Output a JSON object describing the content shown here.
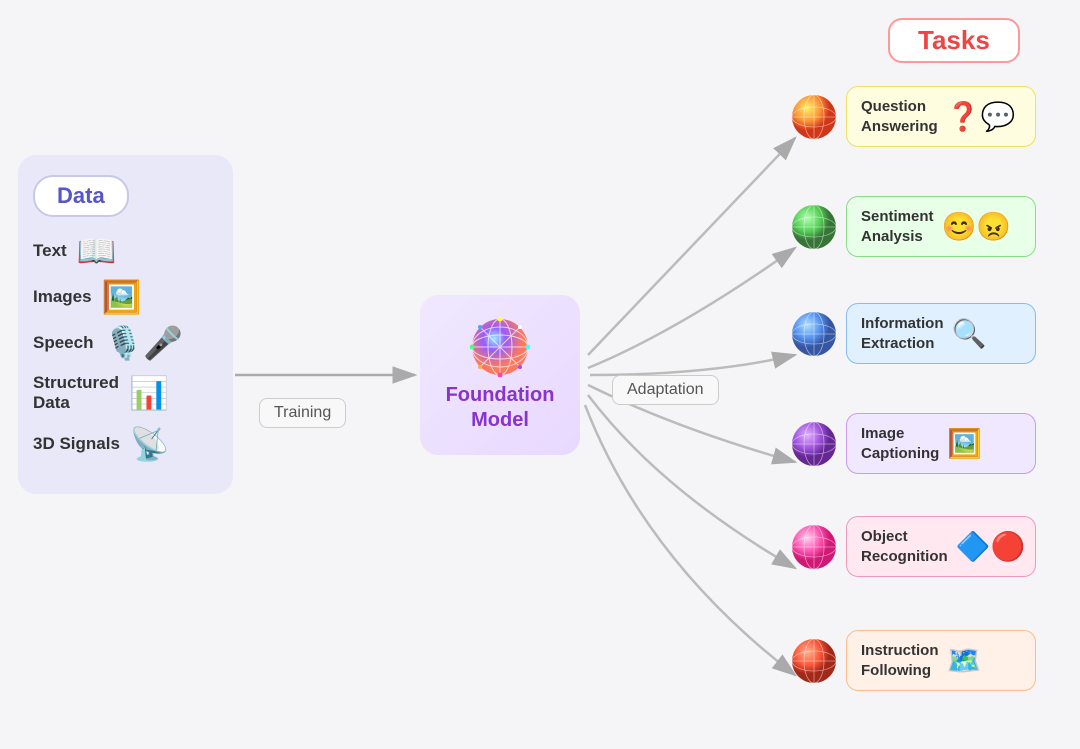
{
  "data_panel": {
    "title": "Data",
    "items": [
      {
        "label": "Text",
        "emoji": "📖"
      },
      {
        "label": "Images",
        "emoji": "🖼️"
      },
      {
        "label": "Speech",
        "emoji": "🎤"
      },
      {
        "label": "Structured Data",
        "emoji": "📊"
      },
      {
        "label": "3D Signals",
        "emoji": "📡"
      }
    ]
  },
  "training_label": "Training",
  "foundation_model_label": "Foundation\nModel",
  "adaptation_label": "Adaptation",
  "tasks_title": "Tasks",
  "tasks": [
    {
      "label": "Question\nAnswering",
      "emoji": "❓💬",
      "bg_class": "bg-yellow",
      "sphere_color1": "#ff6633",
      "sphere_color2": "#ffcc22"
    },
    {
      "label": "Sentiment\nAnalysis",
      "emoji": "😊😠",
      "bg_class": "bg-green",
      "sphere_color1": "#44cc44",
      "sphere_color2": "#88ff44"
    },
    {
      "label": "Information\nExtraction",
      "emoji": "🔍",
      "bg_class": "bg-blue",
      "sphere_color1": "#4488ff",
      "sphere_color2": "#88ccff"
    },
    {
      "label": "Image\nCaptioning",
      "emoji": "🖼️",
      "bg_class": "bg-purple",
      "sphere_color1": "#9944dd",
      "sphere_color2": "#cc88ff"
    },
    {
      "label": "Object\nRecognition",
      "emoji": "🔷🔴",
      "bg_class": "bg-pink",
      "sphere_color1": "#ff44aa",
      "sphere_color2": "#ff88cc"
    },
    {
      "label": "Instruction\nFollowing",
      "emoji": "🗺️",
      "bg_class": "bg-peach",
      "sphere_color1": "#ff3333",
      "sphere_color2": "#ff8866"
    }
  ]
}
